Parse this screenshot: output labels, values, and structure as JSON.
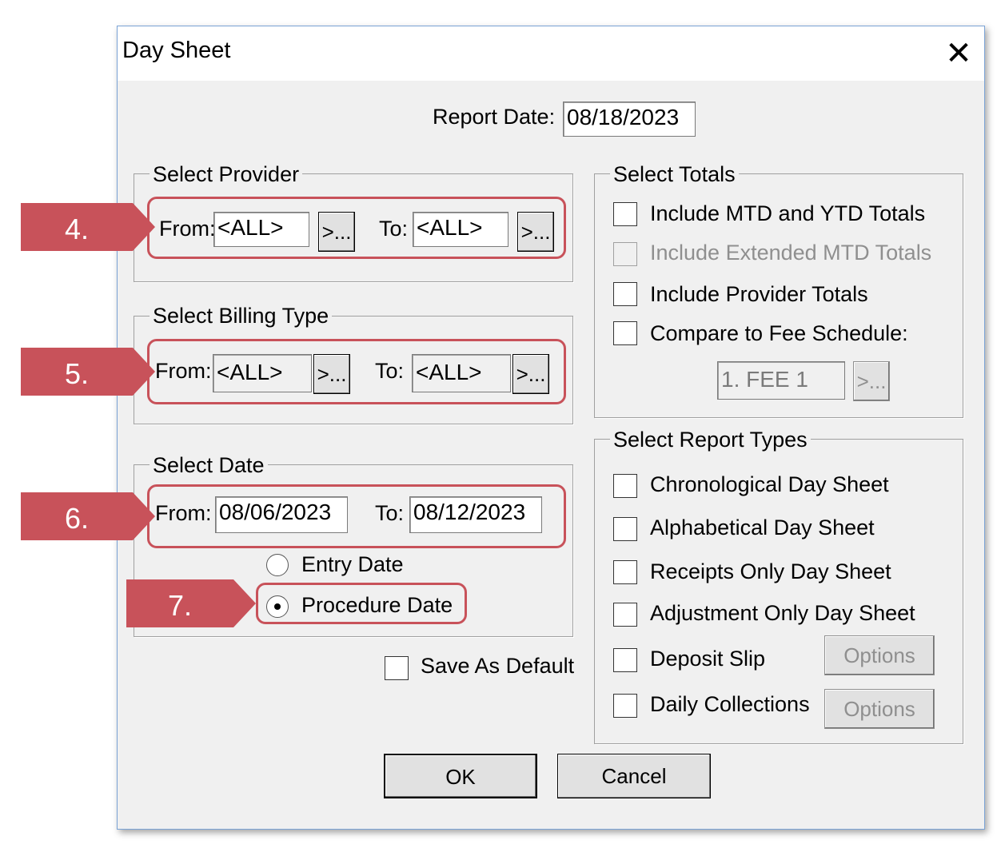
{
  "window": {
    "title": "Day Sheet",
    "close_glyph": "✕"
  },
  "report_date": {
    "label": "Report Date:",
    "value": "08/18/2023"
  },
  "select_provider": {
    "title": "Select Provider",
    "from_label": "From:",
    "from_value": "<ALL>",
    "to_label": "To:",
    "to_value": "<ALL>",
    "browse_label": ">..."
  },
  "select_billing_type": {
    "title": "Select Billing Type",
    "from_label": "From:",
    "from_value": "<ALL>",
    "to_label": "To:",
    "to_value": "<ALL>",
    "browse_label": ">..."
  },
  "select_date": {
    "title": "Select Date",
    "from_label": "From:",
    "from_value": "08/06/2023",
    "to_label": "To:",
    "to_value": "08/12/2023",
    "radios": [
      {
        "label": "Entry Date",
        "selected": false
      },
      {
        "label": "Procedure Date",
        "selected": true
      }
    ]
  },
  "save_as_default": "Save As Default",
  "select_totals": {
    "title": "Select Totals",
    "items": [
      "Include MTD and YTD Totals",
      "Include Extended MTD Totals",
      "Include Provider Totals",
      "Compare to Fee Schedule:"
    ],
    "fee_schedule_value": "1.  FEE 1",
    "browse_label": ">..."
  },
  "select_report_types": {
    "title": "Select Report Types",
    "items": [
      "Chronological Day Sheet",
      "Alphabetical Day Sheet",
      "Receipts Only Day Sheet",
      "Adjustment Only Day Sheet",
      "Deposit Slip",
      "Daily Collections"
    ],
    "options_label": "Options"
  },
  "buttons": {
    "ok": "OK",
    "cancel": "Cancel"
  },
  "callouts": [
    "4.",
    "5.",
    "6.",
    "7."
  ],
  "colors": {
    "callout": "#c8525a",
    "window_border": "#7aa3d6",
    "dialog_bg": "#f0f0f0"
  }
}
